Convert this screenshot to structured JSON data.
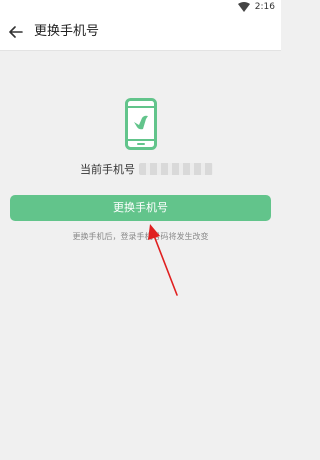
{
  "status_bar": {
    "time": "2:16",
    "wifi_icon": "wifi-icon"
  },
  "header": {
    "title": "更换手机号",
    "back_icon": "arrow-left-icon"
  },
  "illustration": {
    "icon": "phone-icon",
    "color": "#62c48b"
  },
  "current_phone": {
    "label": "当前手机号"
  },
  "actions": {
    "change_label": "更换手机号"
  },
  "hint": "更换手机后，登录手机号码将发生改变",
  "colors": {
    "accent": "#62c48b",
    "annotation_arrow": "#e02020",
    "background": "#f0f0f0"
  }
}
